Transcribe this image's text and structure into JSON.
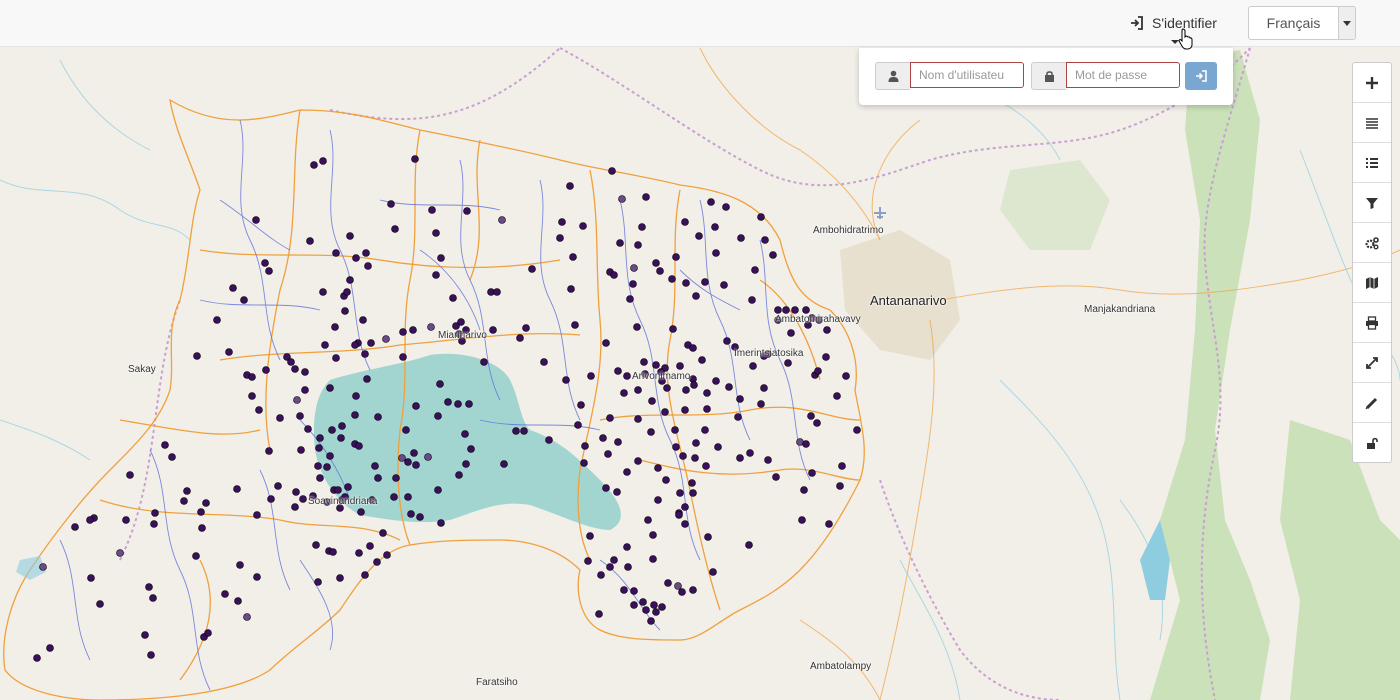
{
  "header": {
    "login_label": "S'identifier",
    "language": "Français"
  },
  "login_form": {
    "username_placeholder": "Nom d'utilisateu",
    "password_placeholder": "Mot de passe"
  },
  "toolbar": {
    "tools": [
      "zoom-in-icon",
      "layers-icon",
      "list-icon",
      "filter-icon",
      "settings-icon",
      "map-icon",
      "print-icon",
      "fullscreen-icon",
      "measure-icon",
      "unlock-icon"
    ]
  },
  "map": {
    "places": {
      "ambohidratrimo": "Ambohidratrimo",
      "antananarivo": "Antananarivo",
      "manjakandriana": "Manjakandriana",
      "sakay": "Sakay",
      "miarinarivo": "Miarinarivo",
      "arivonimamo": "Arivonimamo",
      "imerintsiatosika": "Imerintsiatosika",
      "ambatomirahavavy": "Ambatomirahavavy",
      "soavinandriana": "Soavinandriana",
      "faratsiho": "Faratsiho",
      "ambatolampy": "Ambatolampy"
    },
    "colors": {
      "background": "#f2efe9",
      "river": "#5c6fd8",
      "district": "#f0a03c",
      "boundary": "#c8a0d0",
      "lake": "#6cc3c0",
      "point": "#3a0f5c",
      "forest": "#c6dfb4"
    }
  }
}
